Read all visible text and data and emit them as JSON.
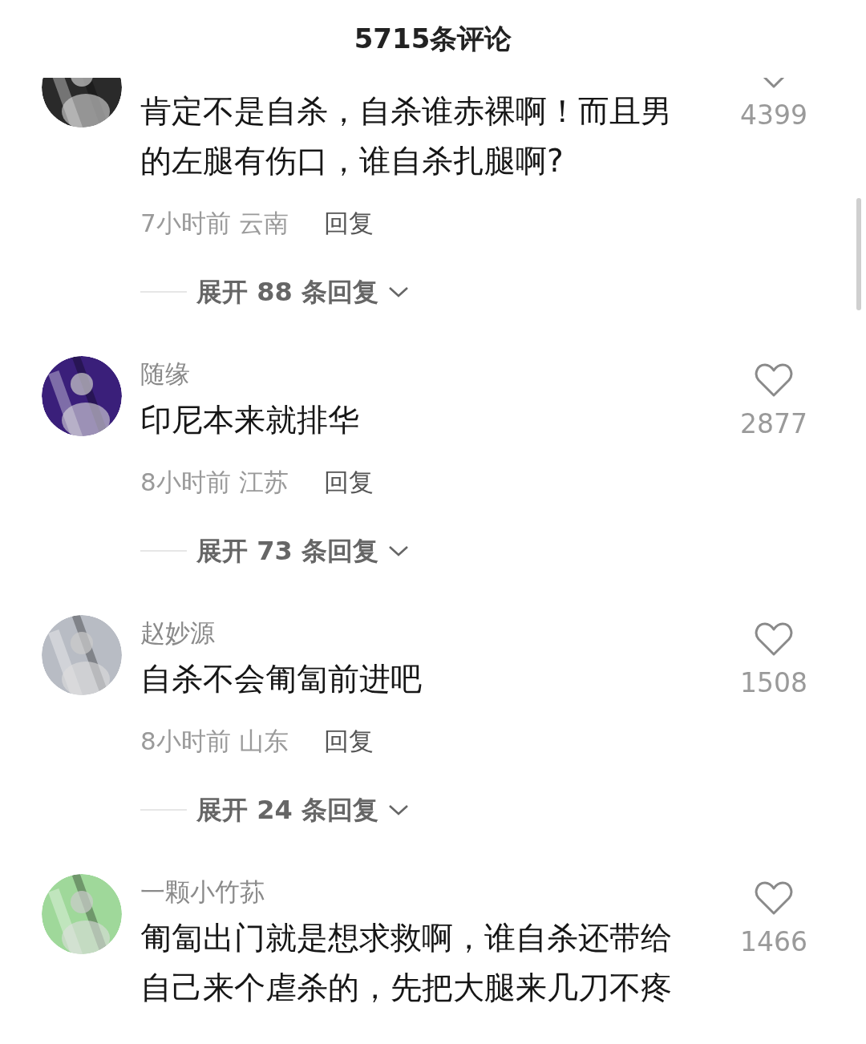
{
  "header": {
    "title": "5715条评论"
  },
  "comments": [
    {
      "text": "肯定不是自杀，自杀谁赤裸啊！而且男的左腿有伤口，谁自杀扎腿啊?",
      "time_region": "7小时前 云南",
      "reply": "回复",
      "expand": "展开 88 条回复",
      "likes": "4399"
    },
    {
      "name": "随缘",
      "text": "印尼本来就排华",
      "time_region": "8小时前 江苏",
      "reply": "回复",
      "expand": "展开 73 条回复",
      "likes": "2877"
    },
    {
      "name": "赵妙源",
      "text": "自杀不会匍匐前进吧",
      "time_region": "8小时前 山东",
      "reply": "回复",
      "expand": "展开 24 条回复",
      "likes": "1508"
    },
    {
      "name": "一颗小竹荪",
      "text": "匍匐出门就是想求救啊，谁自杀还带给自己来个虐杀的，先把大腿来几刀不疼",
      "likes": "1466"
    }
  ]
}
